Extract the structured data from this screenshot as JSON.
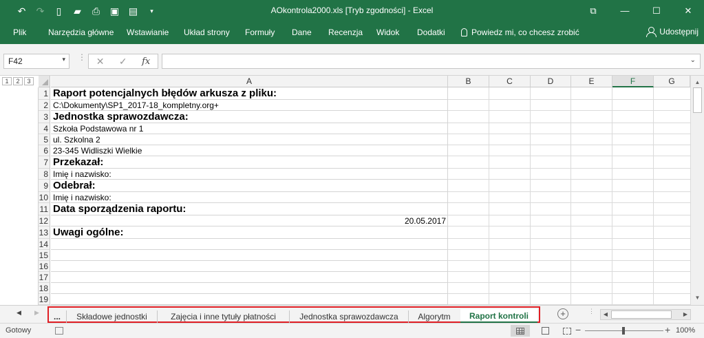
{
  "titlebar": {
    "title": "AOkontrola2000.xls  [Tryb zgodności]  -  Excel",
    "qat_icons": [
      "undo-icon",
      "redo-icon",
      "new-file-icon",
      "open-folder-icon",
      "print-preview-icon",
      "save-icon",
      "save-as-icon",
      "customize-qat-icon"
    ],
    "window_controls": [
      "ribbon-display-icon",
      "minimize-icon",
      "maximize-icon",
      "close-icon"
    ]
  },
  "ribbon": {
    "tabs": [
      "Plik",
      "Narzędzia główne",
      "Wstawianie",
      "Układ strony",
      "Formuły",
      "Dane",
      "Recenzja",
      "Widok",
      "Dodatki"
    ],
    "tell_me": "Powiedz mi, co chcesz zrobić",
    "share": "Udostępnij"
  },
  "formula_bar": {
    "name_box": "F42",
    "fx_label": "fx",
    "formula": ""
  },
  "grid": {
    "outline_levels": [
      "1",
      "2",
      "3"
    ],
    "columns": [
      "A",
      "B",
      "C",
      "D",
      "E",
      "F",
      "G"
    ],
    "active_column": "F",
    "rows": [
      {
        "num": "1",
        "a": "Raport potencjalnych błędów arkusza z pliku:",
        "style": "bold"
      },
      {
        "num": "2",
        "a": "C:\\Dokumenty\\SP1_2017-18_kompletny.org+",
        "style": "normal"
      },
      {
        "num": "3",
        "a": "Jednostka sprawozdawcza:",
        "style": "bold"
      },
      {
        "num": "4",
        "a": "Szkoła Podstawowa nr 1",
        "style": "normal"
      },
      {
        "num": "5",
        "a": "ul. Szkolna 2",
        "style": "normal"
      },
      {
        "num": "6",
        "a": "23-345 Widliszki Wielkie",
        "style": "normal"
      },
      {
        "num": "7",
        "a": "Przekazał:",
        "style": "bold"
      },
      {
        "num": "8",
        "a": "Imię i nazwisko:",
        "style": "normal"
      },
      {
        "num": "9",
        "a": "Odebrał:",
        "style": "bold"
      },
      {
        "num": "10",
        "a": "Imię i nazwisko:",
        "style": "normal"
      },
      {
        "num": "11",
        "a": "Data sporządzenia raportu:",
        "style": "bold"
      },
      {
        "num": "12",
        "a": "20.05.2017",
        "style": "right"
      },
      {
        "num": "13",
        "a": "Uwagi ogólne:",
        "style": "bold"
      },
      {
        "num": "14",
        "a": "",
        "style": "normal"
      },
      {
        "num": "15",
        "a": "",
        "style": "normal"
      },
      {
        "num": "16",
        "a": "",
        "style": "normal"
      },
      {
        "num": "17",
        "a": "",
        "style": "normal"
      },
      {
        "num": "18",
        "a": "",
        "style": "normal"
      },
      {
        "num": "19",
        "a": "",
        "style": "normal"
      }
    ]
  },
  "sheet_tabs": {
    "more": "...",
    "tabs": [
      "Składowe jednostki",
      "Zajęcia i inne tytuły płatności",
      "Jednostka sprawozdawcza",
      "Algorytm",
      "Raport kontroli"
    ],
    "active": "Raport kontroli",
    "highlight_color": "#e01e24"
  },
  "status": {
    "ready": "Gotowy",
    "zoom": "100%"
  },
  "colors": {
    "excel_green": "#217346"
  }
}
